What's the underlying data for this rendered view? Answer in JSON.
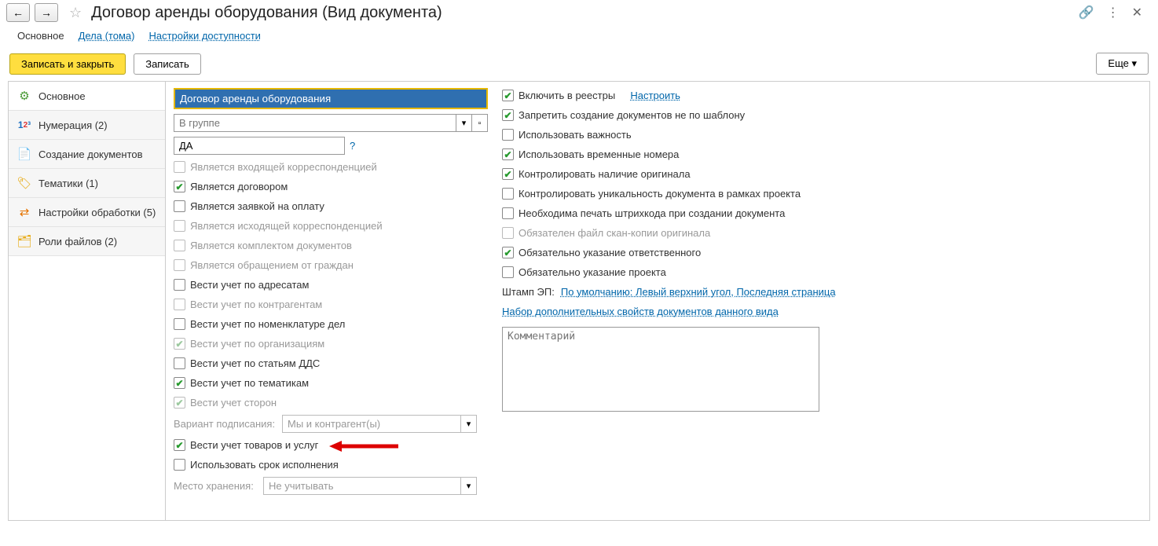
{
  "header": {
    "title": "Договор аренды оборудования (Вид документа)"
  },
  "tabs": {
    "main": "Основное",
    "cases": "Дела (тома)",
    "access": "Настройки доступности"
  },
  "actions": {
    "save_close": "Записать и закрыть",
    "save": "Записать",
    "more": "Еще"
  },
  "sidebar": {
    "main": "Основное",
    "numbering": "Нумерация (2)",
    "creation": "Создание документов",
    "topics": "Тематики (1)",
    "processing": "Настройки обработки (5)",
    "file_roles": "Роли файлов (2)"
  },
  "left": {
    "name_value": "Договор аренды оборудования",
    "group_placeholder": "В группе",
    "code_value": "ДА",
    "chk_incoming": "Является входящей корреспонденцией",
    "chk_contract": "Является договором",
    "chk_payreq": "Является заявкой на оплату",
    "chk_outgoing": "Является исходящей корреспонденцией",
    "chk_docpack": "Является комплектом документов",
    "chk_citizen": "Является обращением от граждан",
    "chk_addr": "Вести учет по адресатам",
    "chk_contragents": "Вести учет по контрагентам",
    "chk_nomenclature": "Вести учет по номенклатуре дел",
    "chk_org": "Вести учет по организациям",
    "chk_dds": "Вести учет по статьям ДДС",
    "chk_topics": "Вести учет по тематикам",
    "chk_sides": "Вести учет сторон",
    "sign_variant_label": "Вариант подписания:",
    "sign_variant_value": "Мы и контрагент(ы)",
    "chk_goods": "Вести учет товаров и услуг",
    "chk_deadline": "Использовать срок исполнения",
    "storage_label": "Место хранения:",
    "storage_value": "Не учитывать"
  },
  "right": {
    "chk_registries": "Включить в реестры",
    "link_configure": "Настроить",
    "chk_forbid": "Запретить создание документов не по шаблону",
    "chk_importance": "Использовать важность",
    "chk_tempnum": "Использовать временные номера",
    "chk_orig": "Контролировать наличие оригинала",
    "chk_unique": "Контролировать уникальность документа в рамках проекта",
    "chk_barcode": "Необходима печать штрихкода при создании документа",
    "chk_scan": "Обязателен файл скан-копии оригинала",
    "chk_responsible": "Обязательно указание ответственного",
    "chk_project": "Обязательно указание проекта",
    "stamp_label": "Штамп ЭП:",
    "stamp_link": "По умолчанию: Левый верхний угол, Последняя страница",
    "props_link": "Набор дополнительных свойств документов данного вида",
    "comment_placeholder": "Комментарий"
  }
}
